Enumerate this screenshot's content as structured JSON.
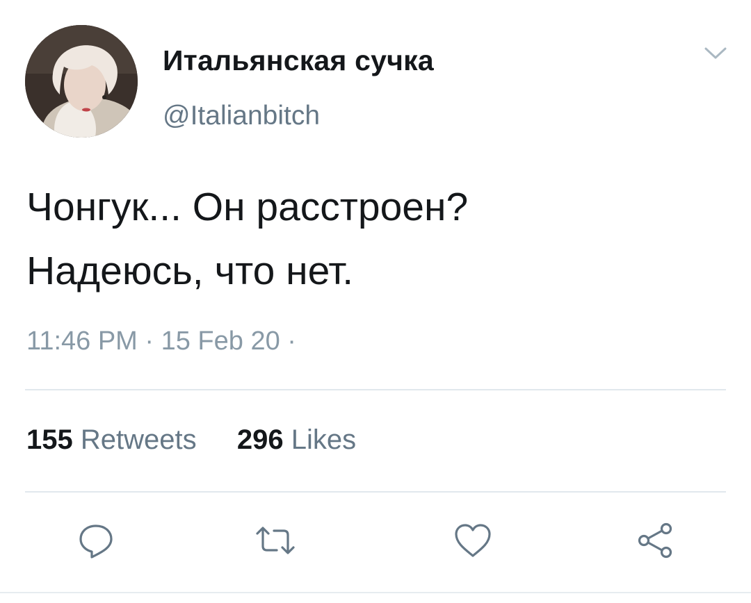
{
  "author": {
    "display_name": "Итальянская сучка",
    "handle": "@Italianbitch"
  },
  "tweet": {
    "lines": [
      "Чонгук... Он расстроен?",
      "Надеюсь, что нет."
    ],
    "timestamp": "11:46 PM · 15 Feb 20 ·"
  },
  "stats": {
    "retweets_count": "155",
    "retweets_label": "Retweets",
    "likes_count": "296",
    "likes_label": "Likes"
  },
  "actions": {
    "reply_icon": "reply-icon",
    "retweet_icon": "retweet-icon",
    "like_icon": "heart-icon",
    "share_icon": "share-icon"
  },
  "colors": {
    "text": "#14171a",
    "secondary": "#657786",
    "icon": "#657786",
    "divider": "#e1e8ed"
  }
}
